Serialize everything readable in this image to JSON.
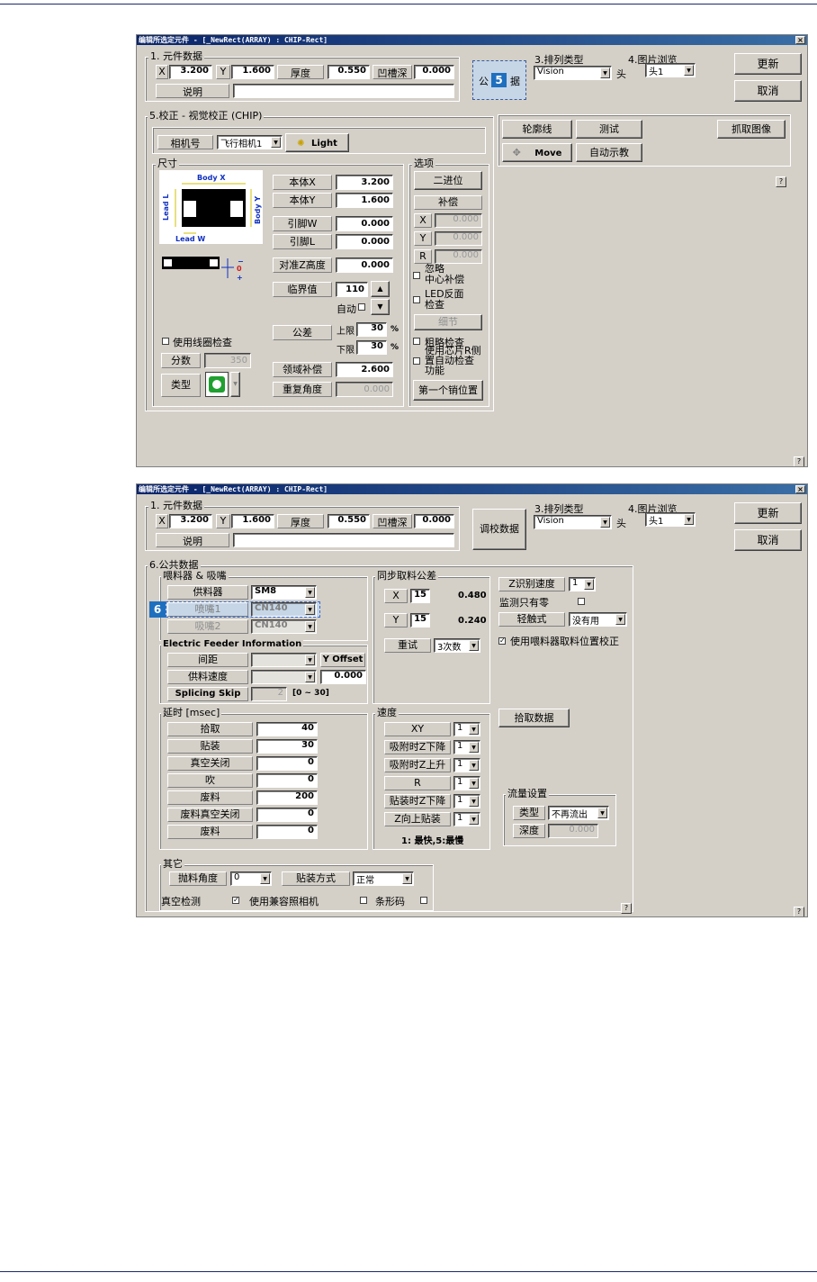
{
  "w1": {
    "title": "编辑所选定元件 - [_NewRect(ARRAY) : CHIP-Rect]",
    "sec1": "1. 元件数据",
    "x_label": "X",
    "x_val": "3.200",
    "y_label": "Y",
    "y_val": "1.600",
    "thick_label": "厚度",
    "thick_val": "0.550",
    "groove_label": "凹槽深",
    "groove_val": "0.000",
    "desc_label": "说明",
    "common_btn_a": "公",
    "badge": "5",
    "common_btn_b": "据",
    "sec3": "3.排列类型",
    "arr_val": "Vision",
    "head_label": "头",
    "sec4": "4.图片浏览",
    "img_val": "头1",
    "update": "更新",
    "cancel": "取消",
    "sec5": "5.校正 - 视觉校正 (CHIP)",
    "cam_label": "相机号",
    "cam_val": "飞行相机1",
    "light": "Light",
    "contour": "轮廓线",
    "test": "测试",
    "capture": "抓取图像",
    "move": "Move",
    "autoteach": "自动示教",
    "size_grp": "尺寸",
    "body_x_lbl": "Body X",
    "body_y_lbl": "Body Y",
    "lead_l_lbl": "Lead L",
    "lead_w_lbl": "Lead W",
    "bodyx_label": "本体X",
    "bodyx_val": "3.200",
    "bodyy_label": "本体Y",
    "bodyy_val": "1.600",
    "leadw_label": "引脚W",
    "leadw_val": "0.000",
    "leadl_label": "引脚L",
    "leadl_val": "0.000",
    "zh_label": "对准Z高度",
    "zh_val": "0.000",
    "thr_label": "临界值",
    "thr_val": "110",
    "auto": "自动",
    "tol_label": "公差",
    "upper": "上限",
    "upper_val": "30",
    "lower": "下限",
    "lower_val": "30",
    "pct": "%",
    "areacomp_label": "领域补偿",
    "areacomp_val": "2.600",
    "reang_label": "重复角度",
    "reang_val": "0.000",
    "coil": "使用线圈检查",
    "score_label": "分数",
    "score_val": "350",
    "type_label": "类型",
    "opt_grp": "选项",
    "binary": "二进位",
    "comp": "补偿",
    "cx": "X",
    "cx_val": "0.000",
    "cy": "Y",
    "cy_val": "0.000",
    "cr": "R",
    "cr_val": "0.000",
    "ignore1": "忽略",
    "ignore2": "中心补偿",
    "led1": "LED反面",
    "led2": "检查",
    "detail": "细节",
    "rough": "粗略检查",
    "chip1": "使用芯片R侧",
    "chip2": "置自动检查",
    "chip3": "功能",
    "firstpin": "第一个销位置",
    "help": "?"
  },
  "w2": {
    "title": "编辑所选定元件 - [_NewRect(ARRAY) : CHIP-Rect]",
    "sec1": "1. 元件数据",
    "x_label": "X",
    "x_val": "3.200",
    "y_label": "Y",
    "y_val": "1.600",
    "thick_label": "厚度",
    "thick_val": "0.550",
    "groove_label": "凹槽深",
    "groove_val": "0.000",
    "desc_label": "说明",
    "calib": "调校数据",
    "sec3": "3.排列类型",
    "arr_val": "Vision",
    "head_label": "头",
    "sec4": "4.图片浏览",
    "img_val": "头1",
    "update": "更新",
    "cancel": "取消",
    "sec6": "6.公共数据",
    "feeder_grp": "喂料器 & 吸嘴",
    "feeder_label": "供料器",
    "feeder_val": "SM8",
    "nozzle1_label": "喷嘴1",
    "nozzle1_val": "CN140",
    "badge": "6",
    "nozzle2_label": "吸嘴2",
    "nozzle2_val": "CN140",
    "ef_grp": "Electric Feeder Information",
    "pitch_label": "间距",
    "yoffset": "Y Offset",
    "fspeed_label": "供料速度",
    "fspeed_val": "0.000",
    "splice_label": "Splicing Skip",
    "splice_val": "2",
    "splice_range": "[0 ~ 30]",
    "sync_grp": "同步取料公差",
    "sx": "X",
    "sx_val": "15",
    "sx_mm": "0.480",
    "sy": "Y",
    "sy_val": "15",
    "sy_mm": "0.240",
    "retry_label": "重试",
    "retry_val": "3次数",
    "zspeed_label": "Z识别速度",
    "zspeed_val": "1",
    "monitor": "监测只有零",
    "touch_label": "轻触式",
    "touch_val": "没有用",
    "usefeeder": "使用喂料器取料位置校正",
    "pick_data": "拾取数据",
    "delay_grp": "延时 [msec]",
    "delays": [
      {
        "label": "拾取",
        "val": "40"
      },
      {
        "label": "贴装",
        "val": "30"
      },
      {
        "label": "真空关闭",
        "val": "0"
      },
      {
        "label": "吹",
        "val": "0"
      },
      {
        "label": "废料",
        "val": "200"
      },
      {
        "label": "废料真空关闭",
        "val": "0"
      },
      {
        "label": "废料",
        "val": "0"
      }
    ],
    "speed_grp": "速度",
    "speeds": [
      {
        "label": "XY",
        "val": "1"
      },
      {
        "label": "吸附时Z下降",
        "val": "1"
      },
      {
        "label": "吸附时Z上升",
        "val": "1"
      },
      {
        "label": "R",
        "val": "1"
      },
      {
        "label": "贴装时Z下降",
        "val": "1"
      },
      {
        "label": "Z向上贴装",
        "val": "1"
      }
    ],
    "speed_note": "1: 最快,5:最慢",
    "flow_grp": "流量设置",
    "flow_type_label": "类型",
    "flow_type_val": "不再流出",
    "flow_depth_label": "深度",
    "flow_depth_val": "0.000",
    "other_grp": "其它",
    "throw_label": "抛料角度",
    "throw_val": "0",
    "mount_label": "贴装方式",
    "mount_val": "正常",
    "vacuum": "真空检测",
    "compat": "使用兼容照相机",
    "barcode": "条形码",
    "help": "?"
  }
}
